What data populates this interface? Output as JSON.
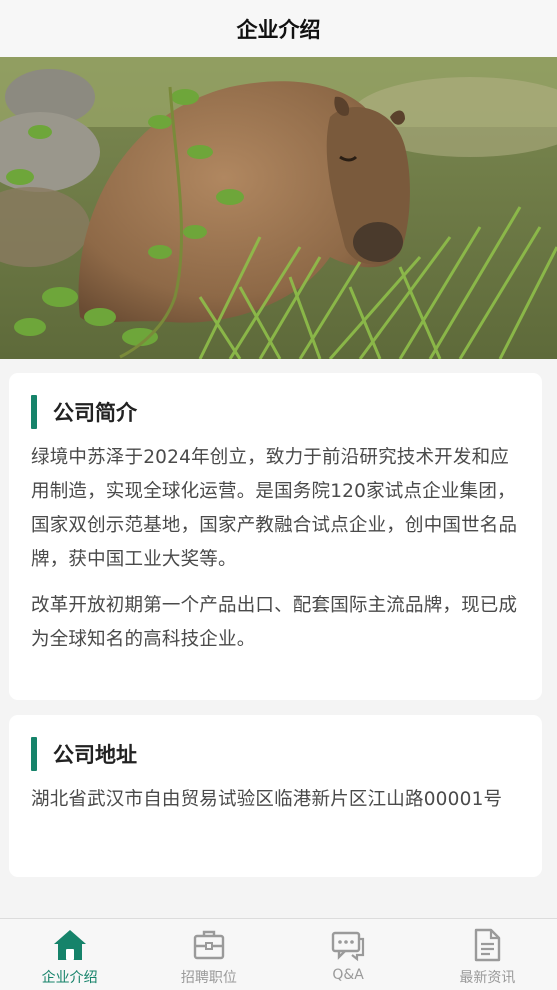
{
  "header": {
    "title": "企业介绍"
  },
  "hero": {
    "subject": "capybara-photo",
    "alt": "capybara resting in grass"
  },
  "intro": {
    "title": "公司简介",
    "paragraphs": [
      "绿境中苏泽于2024年创立，致力于前沿研究技术开发和应用制造，实现全球化运营。是国务院120家试点企业集团，国家双创示范基地，国家产教融合试点企业，创中国世名品牌，获中国工业大奖等。",
      "改革开放初期第一个产品出口、配套国际主流品牌，现已成为全球知名的高科技企业。"
    ]
  },
  "address": {
    "title": "公司地址",
    "text": "湖北省武汉市自由贸易试验区临港新片区江山路00001号"
  },
  "tabbar": {
    "active_color": "#16836a",
    "inactive_color": "#9a9a9a",
    "items": [
      {
        "label": "企业介绍",
        "icon": "home-icon",
        "active": true
      },
      {
        "label": "招聘职位",
        "icon": "briefcase-icon",
        "active": false
      },
      {
        "label": "Q&A",
        "icon": "chat-bubbles-icon",
        "active": false
      },
      {
        "label": "最新资讯",
        "icon": "document-icon",
        "active": false
      }
    ]
  }
}
